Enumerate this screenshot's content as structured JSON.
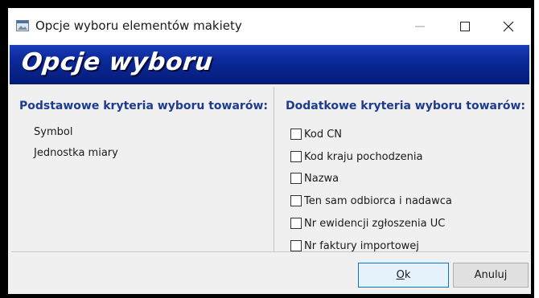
{
  "window": {
    "title": "Opcje wyboru elementów makiety",
    "icons": {
      "app": "app-window-icon",
      "minimize": "minimize-icon",
      "maximize": "maximize-icon",
      "close": "close-icon"
    }
  },
  "banner": {
    "title": "Opcje wyboru"
  },
  "basic_criteria": {
    "heading": "Podstawowe kryteria wyboru towarów:",
    "items": [
      "Symbol",
      "Jednostka miary"
    ]
  },
  "additional_criteria": {
    "heading": "Dodatkowe kryteria wyboru towarów:",
    "options": [
      {
        "label": "Kod CN",
        "checked": false
      },
      {
        "label": "Kod kraju pochodzenia",
        "checked": false
      },
      {
        "label": "Nazwa",
        "checked": false
      },
      {
        "label": "Ten sam odbiorca i nadawca",
        "checked": false
      },
      {
        "label": "Nr ewidencji zgłoszenia UC",
        "checked": false
      },
      {
        "label": "Nr faktury importowej",
        "checked": false
      }
    ]
  },
  "buttons": {
    "ok_first": "O",
    "ok_rest": "k",
    "cancel": "Anuluj"
  },
  "colors": {
    "banner": "#0c2a9c",
    "heading": "#1d3b8f",
    "ok_border": "#0078d7"
  }
}
